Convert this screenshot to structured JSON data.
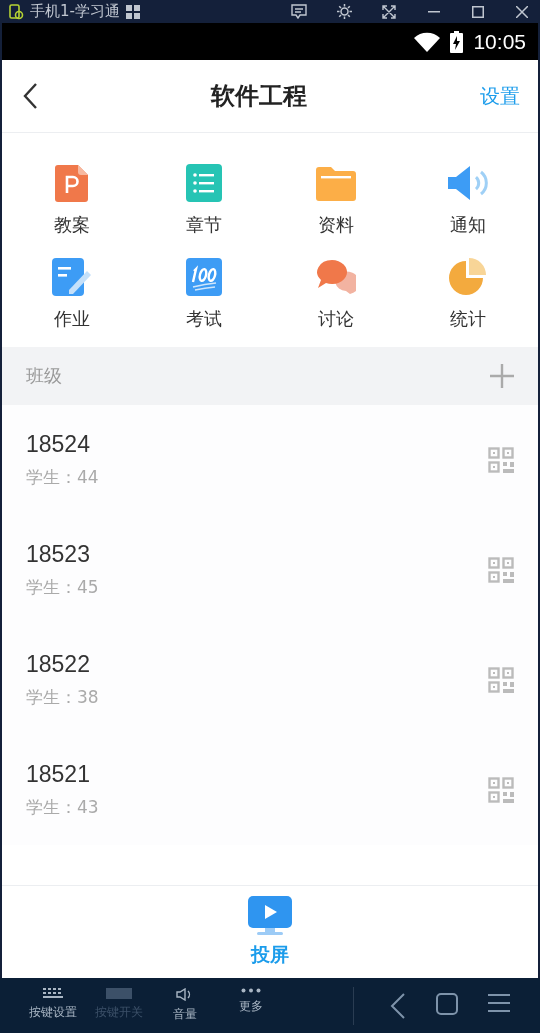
{
  "emulator": {
    "title": "手机1-学习通"
  },
  "status_bar": {
    "time": "10:05"
  },
  "header": {
    "title": "软件工程",
    "action": "设置"
  },
  "features": [
    {
      "label": "教案"
    },
    {
      "label": "章节"
    },
    {
      "label": "资料"
    },
    {
      "label": "通知"
    },
    {
      "label": "作业"
    },
    {
      "label": "考试"
    },
    {
      "label": "讨论"
    },
    {
      "label": "统计"
    }
  ],
  "section": {
    "title": "班级"
  },
  "classes": [
    {
      "name": "18524",
      "students": "学生：44"
    },
    {
      "name": "18523",
      "students": "学生：45"
    },
    {
      "name": "18522",
      "students": "学生：38"
    },
    {
      "name": "18521",
      "students": "学生：43"
    }
  ],
  "bottom": {
    "label": "投屏"
  },
  "emulator_bar": [
    {
      "label": "按键设置",
      "disabled": false
    },
    {
      "label": "按键开关",
      "disabled": true
    },
    {
      "label": "音量",
      "disabled": false
    },
    {
      "label": "更多",
      "disabled": false
    }
  ]
}
